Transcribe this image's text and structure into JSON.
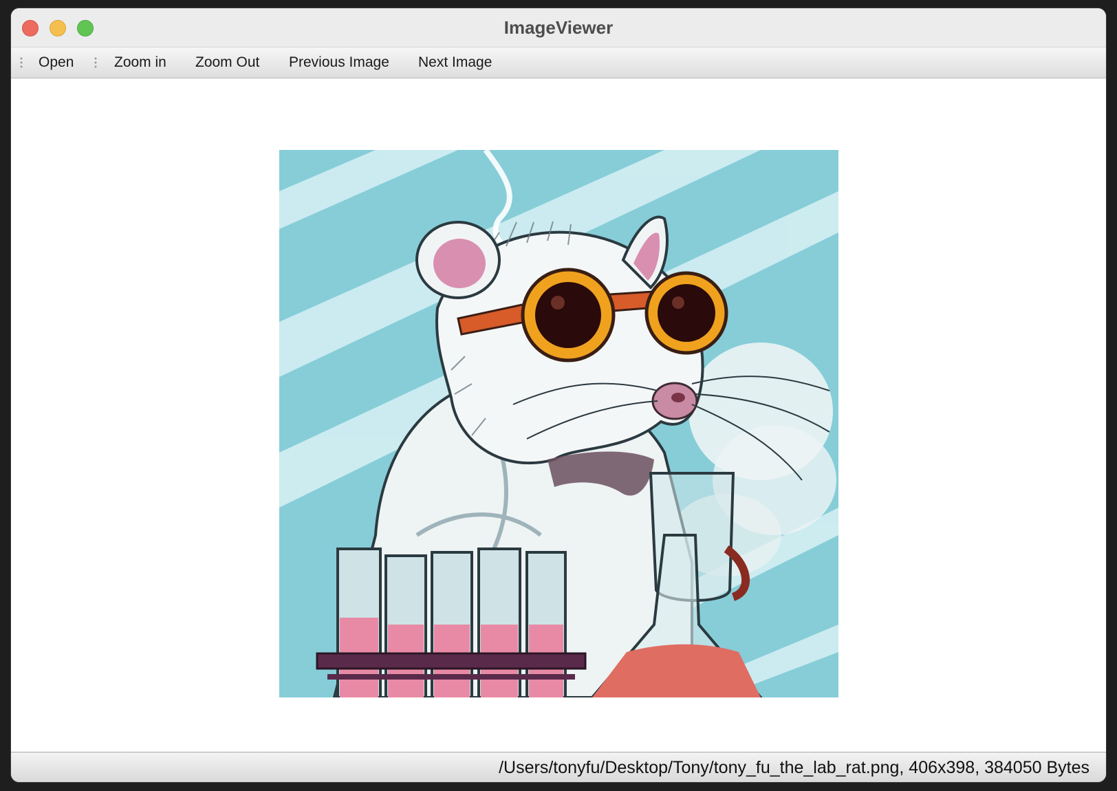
{
  "window": {
    "title": "ImageViewer"
  },
  "toolbar": {
    "open_label": "Open",
    "zoom_in_label": "Zoom in",
    "zoom_out_label": "Zoom Out",
    "previous_label": "Previous Image",
    "next_label": "Next Image"
  },
  "image": {
    "icon": "lab-rat-illustration",
    "background_color": "#86cdd8",
    "liquid_color": "#e88aa5",
    "flask_liquid_color": "#e06d62"
  },
  "status": {
    "text": "/Users/tonyfu/Desktop/Tony/tony_fu_the_lab_rat.png, 406x398, 384050 Bytes"
  }
}
